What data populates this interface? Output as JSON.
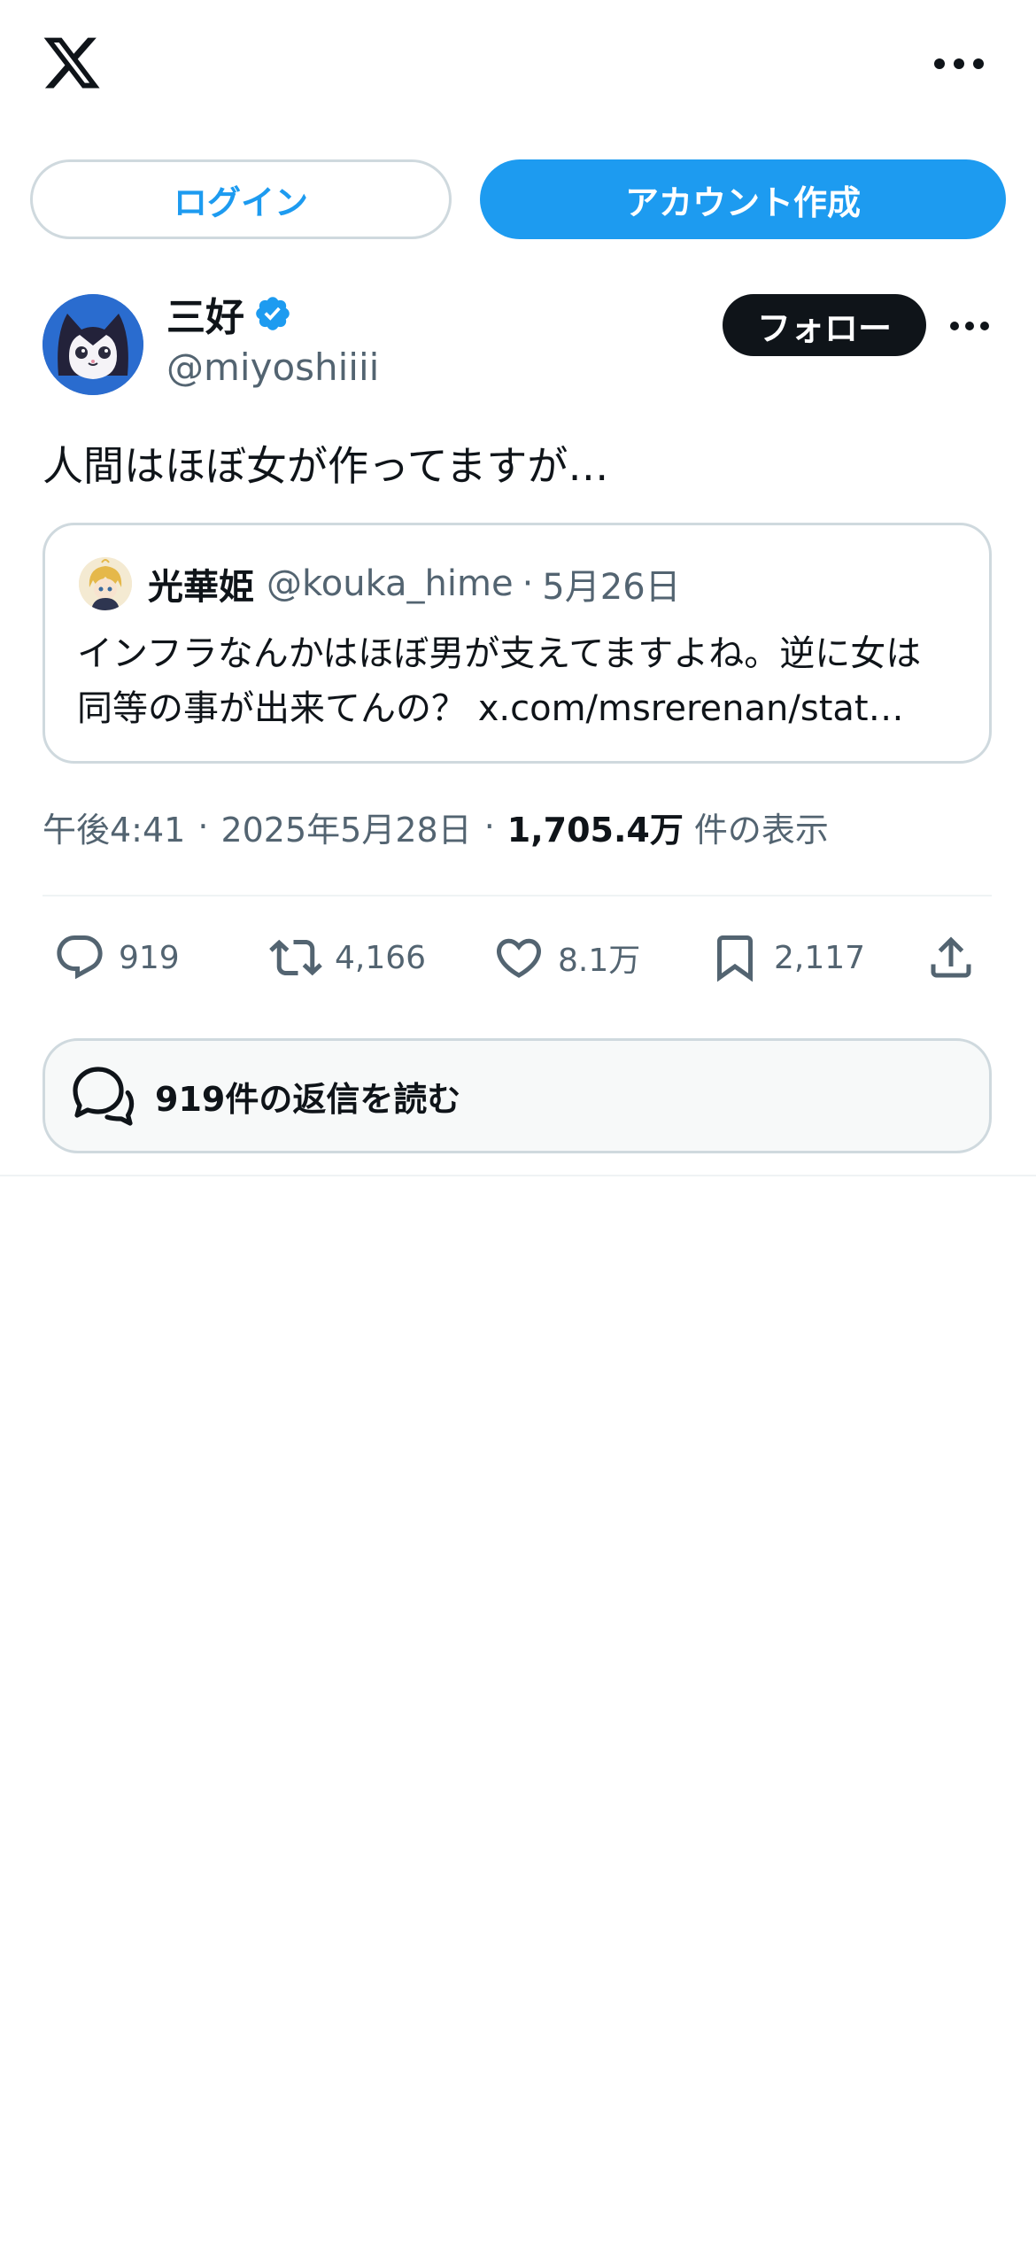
{
  "header": {
    "logo_icon": "x-logo-icon",
    "more_icon": "more-horizontal-icon"
  },
  "auth": {
    "login_label": "ログイン",
    "signup_label": "アカウント作成"
  },
  "post": {
    "author_name": "三好",
    "verified_icon": "verified-badge-icon",
    "author_handle": "@miyoshiiii",
    "follow_label": "フォロー",
    "text": "人間はほぼ女が作ってますが…",
    "quoted": {
      "author_name": "光華姫",
      "author_handle": "@kouka_hime",
      "separator": "·",
      "date": "5月26日",
      "text_line1": "インフラなんかはほぼ男が支えてますよね。逆に女は",
      "text_line2": "同等の事が出来てんの？ x.com/msrerenan/stat…"
    },
    "meta": {
      "time": "午後4:41",
      "separator": "·",
      "date": "2025年5月28日",
      "views_count": "1,705.4万",
      "views_label": "件の表示"
    },
    "actions": {
      "replies": "919",
      "reposts": "4,166",
      "likes": "8.1万",
      "bookmarks": "2,117"
    },
    "read_replies_label": "919件の返信を読む"
  },
  "colors": {
    "accent": "#1d9bf0",
    "text_primary": "#0f1419",
    "text_secondary": "#536471",
    "border": "#cfd9de"
  }
}
